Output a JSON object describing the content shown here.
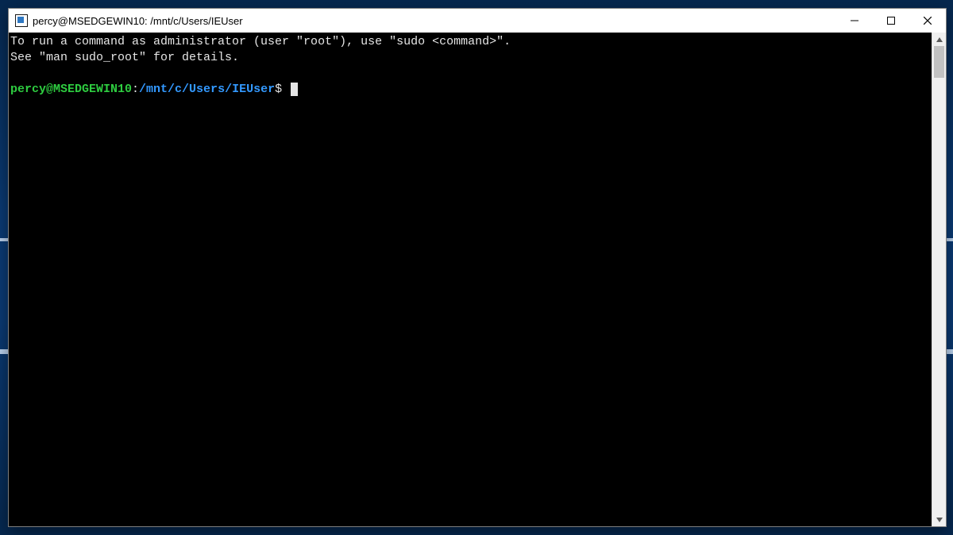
{
  "window": {
    "title": "percy@MSEDGEWIN10: /mnt/c/Users/IEUser"
  },
  "terminal": {
    "output": [
      "To run a command as administrator (user \"root\"), use \"sudo <command>\".",
      "See \"man sudo_root\" for details.",
      ""
    ],
    "prompt": {
      "user_host": "percy@MSEDGEWIN10",
      "colon": ":",
      "cwd": "/mnt/c/Users/IEUser",
      "sigil": "$"
    },
    "input": ""
  },
  "controls": {
    "minimize": "Minimize",
    "maximize": "Maximize",
    "close": "Close",
    "scroll_up": "Scroll up",
    "scroll_down": "Scroll down"
  }
}
